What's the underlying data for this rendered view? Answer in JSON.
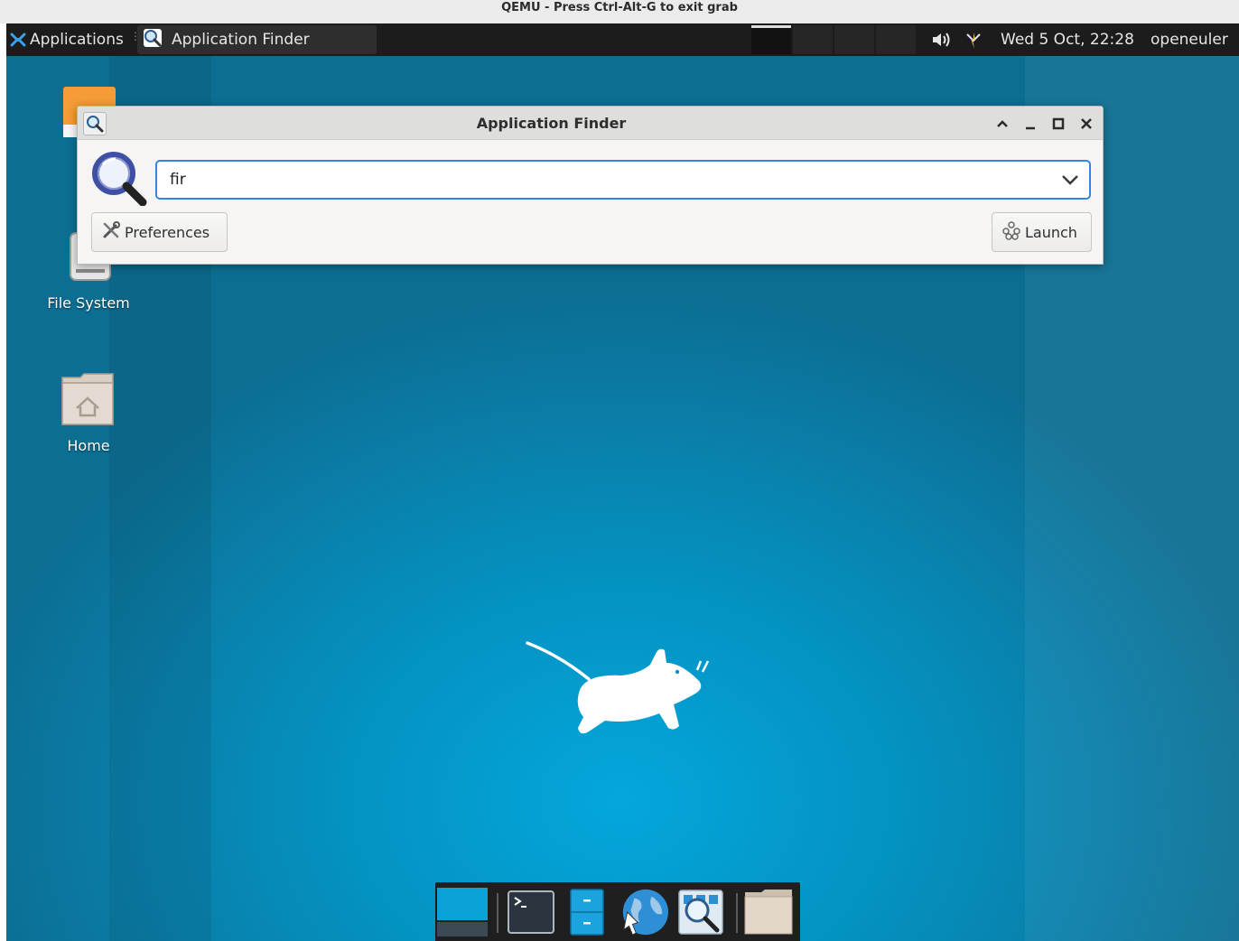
{
  "host": {
    "title": "QEMU - Press Ctrl-Alt-G to exit grab"
  },
  "panel": {
    "applications_label": "Applications",
    "task_label": "Application Finder",
    "clock": "Wed  5 Oct, 22:28",
    "user": "openeuler"
  },
  "desktop": {
    "icons": [
      {
        "label": "File System"
      },
      {
        "label": "Home"
      }
    ]
  },
  "appfinder": {
    "title": "Application Finder",
    "search_value": "fir",
    "preferences_label": "Preferences",
    "launch_label": "Launch"
  },
  "colors": {
    "accent": "#3584e4",
    "desktop": "#0491c0",
    "panel": "#1c1c1c"
  },
  "dock": {
    "items": [
      "show-desktop",
      "terminal",
      "file-manager",
      "web-browser",
      "app-finder",
      "home-folder"
    ]
  }
}
